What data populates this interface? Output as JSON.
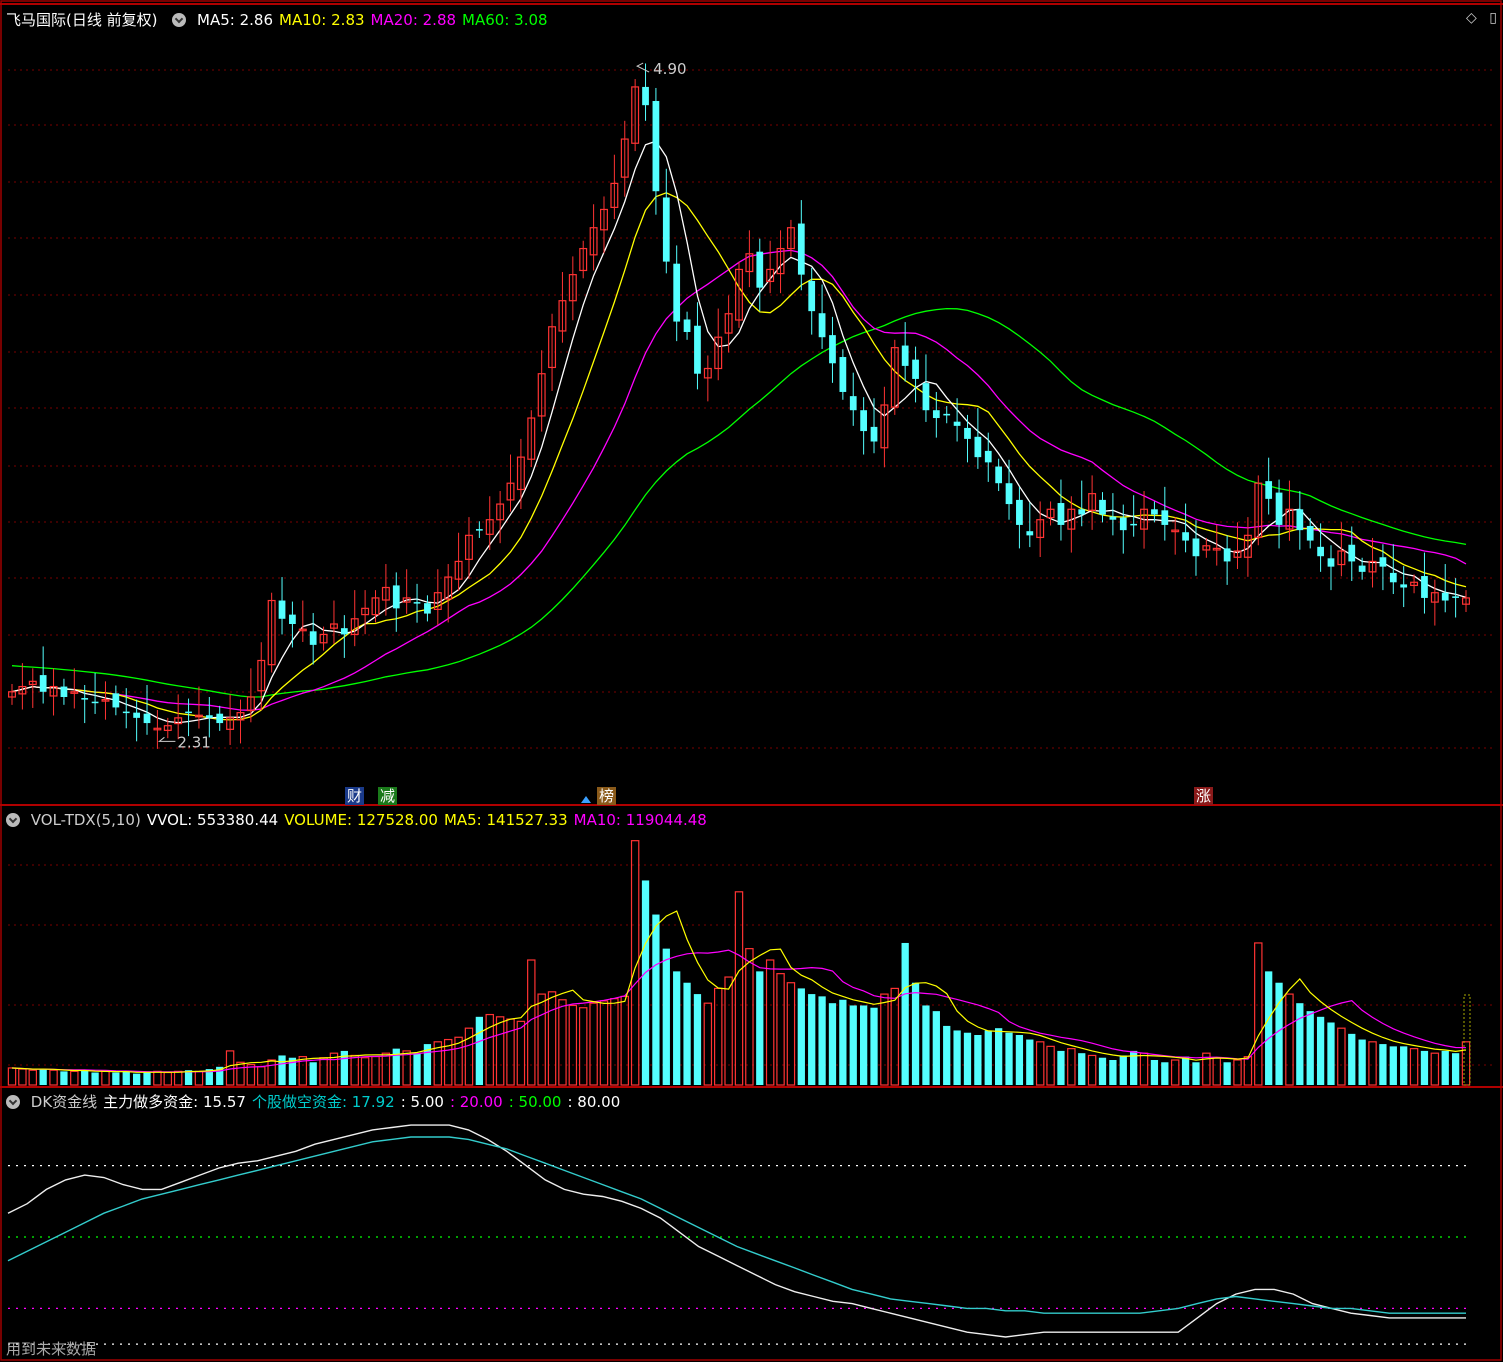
{
  "price_panel": {
    "title": "飞马国际(日线 前复权)",
    "ma_labels": [
      {
        "text": "MA5: 2.86",
        "color": "#ffffff"
      },
      {
        "text": "MA10: 2.83",
        "color": "#ffff00"
      },
      {
        "text": "MA20: 2.88",
        "color": "#ff00ff"
      },
      {
        "text": "MA60: 3.08",
        "color": "#00ff00"
      }
    ],
    "high_label": "4.90",
    "low_label": "2.31",
    "badges": [
      {
        "text": "财",
        "bg": "#1a3a8a"
      },
      {
        "text": "减",
        "bg": "#1a7a1a"
      },
      {
        "text": "榜",
        "bg": "#8a5a1a"
      },
      {
        "text": "涨",
        "bg": "#8a1a1a"
      }
    ]
  },
  "volume_panel": {
    "labels": [
      {
        "text": "VOL-TDX(5,10)",
        "color": "#cccccc"
      },
      {
        "text": "VVOL: 553380.44",
        "color": "#ffffff"
      },
      {
        "text": "VOLUME: 127528.00",
        "color": "#ffff00"
      },
      {
        "text": "MA5: 141527.33",
        "color": "#ffff00"
      },
      {
        "text": "MA10: 119044.48",
        "color": "#ff00ff"
      }
    ]
  },
  "dk_panel": {
    "labels": [
      {
        "text": "DK资金线",
        "color": "#cccccc"
      },
      {
        "text": "主力做多资金: 15.57",
        "color": "#ffffff"
      },
      {
        "text": "个股做空资金: 17.92",
        "color": "#00cccc"
      },
      {
        "text": ": 5.00",
        "color": "#ffffff"
      },
      {
        "text": ": 20.00",
        "color": "#ff00ff"
      },
      {
        "text": ": 50.00",
        "color": "#00ff00"
      },
      {
        "text": ": 80.00",
        "color": "#ffffff"
      }
    ],
    "footnote": "用到未来数据"
  },
  "icons": {
    "diamond": "diamond-icon",
    "window": "window-icon"
  },
  "colors": {
    "up": "#ff3333",
    "down": "#54ffff",
    "ma5": "#ffffff",
    "ma10": "#ffff00",
    "ma20": "#ff00ff",
    "ma60": "#00ff00",
    "grid": "#7a0000"
  },
  "chart_data": [
    {
      "type": "candlestick",
      "title": "飞马国际(日线 前复权)",
      "ylim": [
        2.2,
        5.0
      ],
      "annotations": [
        {
          "label": "4.90",
          "type": "high"
        },
        {
          "label": "2.31",
          "type": "low"
        }
      ],
      "close": [
        2.5,
        2.52,
        2.54,
        2.5,
        2.52,
        2.48,
        2.5,
        2.47,
        2.46,
        2.47,
        2.44,
        2.42,
        2.4,
        2.38,
        2.36,
        2.37,
        2.4,
        2.42,
        2.41,
        2.4,
        2.38,
        2.4,
        2.42,
        2.48,
        2.62,
        2.85,
        2.78,
        2.76,
        2.74,
        2.68,
        2.72,
        2.76,
        2.72,
        2.78,
        2.82,
        2.86,
        2.9,
        2.82,
        2.86,
        2.84,
        2.8,
        2.88,
        2.94,
        3.0,
        3.1,
        3.12,
        3.16,
        3.22,
        3.3,
        3.4,
        3.55,
        3.72,
        3.9,
        4.0,
        4.1,
        4.2,
        4.28,
        4.35,
        4.45,
        4.62,
        4.82,
        4.75,
        4.42,
        4.15,
        3.92,
        3.88,
        3.72,
        3.74,
        3.86,
        3.95,
        4.12,
        4.18,
        4.05,
        4.12,
        4.2,
        4.28,
        4.1,
        3.96,
        3.86,
        3.76,
        3.65,
        3.58,
        3.5,
        3.46,
        3.6,
        3.82,
        3.75,
        3.7,
        3.58,
        3.55,
        3.56,
        3.52,
        3.47,
        3.4,
        3.38,
        3.3,
        3.22,
        3.14,
        3.1,
        3.16,
        3.2,
        3.14,
        3.2,
        3.18,
        3.26,
        3.18,
        3.16,
        3.12,
        3.14,
        3.2,
        3.18,
        3.14,
        3.12,
        3.08,
        3.02,
        3.06,
        3.05,
        3.0,
        3.04,
        3.1,
        3.3,
        3.24,
        3.14,
        3.2,
        3.12,
        3.08,
        3.02,
        2.98,
        3.04,
        3.0,
        2.96,
        3.0,
        2.98,
        2.92,
        2.9,
        2.92,
        2.86,
        2.88,
        2.85,
        2.86,
        2.86
      ]
    },
    {
      "type": "bar",
      "title": "VOL-TDX(5,10)",
      "values": [
        15,
        14,
        13,
        14,
        13,
        12,
        12,
        13,
        11,
        12,
        11,
        12,
        10,
        11,
        12,
        11,
        12,
        13,
        12,
        14,
        16,
        30,
        20,
        18,
        16,
        22,
        26,
        24,
        25,
        20,
        24,
        28,
        30,
        26,
        24,
        25,
        28,
        32,
        30,
        28,
        36,
        38,
        40,
        42,
        50,
        60,
        62,
        60,
        58,
        56,
        110,
        80,
        82,
        75,
        70,
        68,
        72,
        74,
        76,
        78,
        215,
        180,
        150,
        120,
        100,
        90,
        80,
        72,
        85,
        95,
        170,
        120,
        100,
        110,
        98,
        90,
        85,
        80,
        78,
        72,
        75,
        70,
        70,
        68,
        80,
        85,
        125,
        90,
        70,
        65,
        52,
        48,
        46,
        44,
        48,
        50,
        46,
        44,
        40,
        38,
        34,
        30,
        32,
        28,
        26,
        24,
        22,
        26,
        30,
        28,
        22,
        20,
        22,
        25,
        20,
        28,
        24,
        20,
        22,
        25,
        125,
        100,
        90,
        80,
        72,
        65,
        60,
        55,
        50,
        45,
        40,
        38,
        36,
        34,
        34,
        32,
        30,
        28,
        30,
        28,
        38
      ]
    },
    {
      "type": "line",
      "title": "DK资金线",
      "ylim": [
        0,
        100
      ],
      "series": [
        {
          "name": "主力做多资金",
          "values": [
            60,
            64,
            70,
            74,
            76,
            75,
            72,
            70,
            70,
            73,
            76,
            79,
            81,
            82,
            84,
            86,
            89,
            91,
            93,
            95,
            96,
            97,
            97,
            97,
            95,
            91,
            86,
            80,
            74,
            70,
            68,
            67,
            65,
            62,
            58,
            52,
            46,
            42,
            38,
            34,
            30,
            27,
            25,
            23,
            22,
            20,
            18,
            16,
            14,
            12,
            10,
            9,
            8,
            9,
            10,
            10,
            10,
            10,
            10,
            10,
            10,
            10,
            16,
            22,
            26,
            28,
            28,
            26,
            22,
            20,
            18,
            17,
            16,
            16,
            16,
            16,
            16
          ]
        },
        {
          "name": "个股做空资金",
          "values": [
            40,
            44,
            48,
            52,
            56,
            60,
            63,
            66,
            68,
            70,
            72,
            74,
            76,
            78,
            80,
            82,
            84,
            86,
            88,
            90,
            91,
            92,
            92,
            92,
            91,
            89,
            87,
            84,
            81,
            78,
            75,
            72,
            69,
            66,
            62,
            58,
            54,
            50,
            46,
            43,
            40,
            37,
            34,
            31,
            28,
            26,
            24,
            23,
            22,
            21,
            20,
            20,
            19,
            19,
            18,
            18,
            18,
            18,
            18,
            18,
            19,
            20,
            22,
            24,
            25,
            24,
            23,
            22,
            21,
            20,
            20,
            19,
            18,
            18,
            18,
            18,
            18
          ]
        }
      ],
      "reference_lines": [
        5,
        20,
        50,
        80
      ]
    }
  ]
}
